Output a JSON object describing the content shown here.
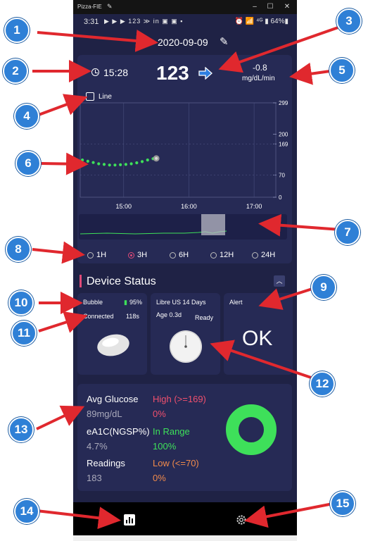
{
  "window": {
    "title": "Pizza-FIE",
    "min": "–",
    "max": "☐",
    "close": "✕"
  },
  "status_bar": {
    "time": "3:31",
    "icons": "▶ ▶ ▶ 123 ≫ in ▣ ▣ ▪",
    "right": "⏰ 📶 ⁴ᴳ ▮ 64%▮"
  },
  "date": "2020-09-09",
  "reading": {
    "time": "15:28",
    "glucose": "123",
    "delta": "-0.8",
    "unit": "mg/dL/min"
  },
  "line_toggle": {
    "label": "Line",
    "checked": false
  },
  "chart_data": {
    "type": "scatter",
    "y_ticks": [
      "299",
      "200",
      "169",
      "70",
      "0"
    ],
    "x_ticks": [
      "15:00",
      "16:00",
      "17:00"
    ],
    "ylim": [
      0,
      299
    ],
    "points": [
      {
        "t": "14:22",
        "v": 118
      },
      {
        "t": "14:27",
        "v": 114
      },
      {
        "t": "14:32",
        "v": 110
      },
      {
        "t": "14:37",
        "v": 106
      },
      {
        "t": "14:42",
        "v": 104
      },
      {
        "t": "14:47",
        "v": 102
      },
      {
        "t": "14:52",
        "v": 102
      },
      {
        "t": "14:57",
        "v": 103
      },
      {
        "t": "15:02",
        "v": 104
      },
      {
        "t": "15:07",
        "v": 106
      },
      {
        "t": "15:12",
        "v": 109
      },
      {
        "t": "15:17",
        "v": 113
      },
      {
        "t": "15:22",
        "v": 118
      },
      {
        "t": "15:27",
        "v": 122
      }
    ],
    "current": {
      "t": "15:30",
      "v": 123
    },
    "point_color": "#3ee05a",
    "range_band": [
      70,
      169
    ]
  },
  "range_options": [
    {
      "label": "1H",
      "selected": false
    },
    {
      "label": "3H",
      "selected": true
    },
    {
      "label": "6H",
      "selected": false
    },
    {
      "label": "12H",
      "selected": false
    },
    {
      "label": "24H",
      "selected": false
    }
  ],
  "device_status": {
    "title": "Device Status",
    "bubble": {
      "name": "Bubble",
      "battery": "95%",
      "state": "Connected",
      "age": "118s"
    },
    "sensor": {
      "name": "Libre US 14 Days",
      "age": "Age 0.3d",
      "state": "Ready"
    },
    "alert": {
      "label": "Alert",
      "value": "OK"
    }
  },
  "stats": {
    "avg_label": "Avg Glucose",
    "avg_value": "89mg/dL",
    "high_label": "High  (>=169)",
    "high_value": "0%",
    "ea1c_label": "eA1C(NGSP%)",
    "ea1c_value": "4.7%",
    "inrange_label": "In Range",
    "inrange_value": "100%",
    "readings_label": "Readings",
    "readings_value": "183",
    "low_label": "Low (<=70)",
    "low_value": "0%",
    "colors": {
      "high": "#f0506e",
      "inrange": "#3ee05a",
      "low": "#f08a4b"
    },
    "donut": {
      "in_range": 100,
      "high": 0,
      "low": 0
    }
  },
  "nav": {
    "stats_icon": "bar-chart-icon",
    "settings_icon": "gear-icon"
  },
  "annotations": [
    "1",
    "2",
    "3",
    "4",
    "5",
    "6",
    "7",
    "8",
    "9",
    "10",
    "11",
    "12",
    "13",
    "14",
    "15"
  ]
}
